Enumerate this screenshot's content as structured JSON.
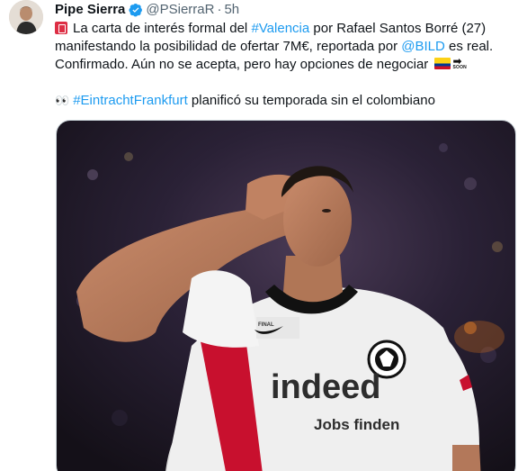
{
  "tweet": {
    "display_name": "Pipe Sierra",
    "handle": "@PSierraR",
    "separator": "·",
    "time": "5h",
    "verified": true,
    "text": {
      "part1": "La carta de interés formal del ",
      "hashtag_valencia": "#Valencia",
      "part2": " por Rafael Santos Borré (27) manifestando la posibilidad de ofertar 7M€, reportada por ",
      "mention_bild": "@BILD",
      "part3": " es real. Confirmado. Aún no se acepta, pero hay opciones de negociar",
      "soon_label": "SOON",
      "hashtag_eintracht": "#EintrachtFrankfurt",
      "part4": " planificó su temporada sin el colombiano"
    },
    "media": {
      "shirt_sponsor": "indeed",
      "shirt_sponsor_sub": "Jobs finden",
      "shirt_patch": "FINAL"
    }
  },
  "colors": {
    "link": "#1d9bf0",
    "verified": "#1d9bf0",
    "secondary_text": "#536471"
  }
}
